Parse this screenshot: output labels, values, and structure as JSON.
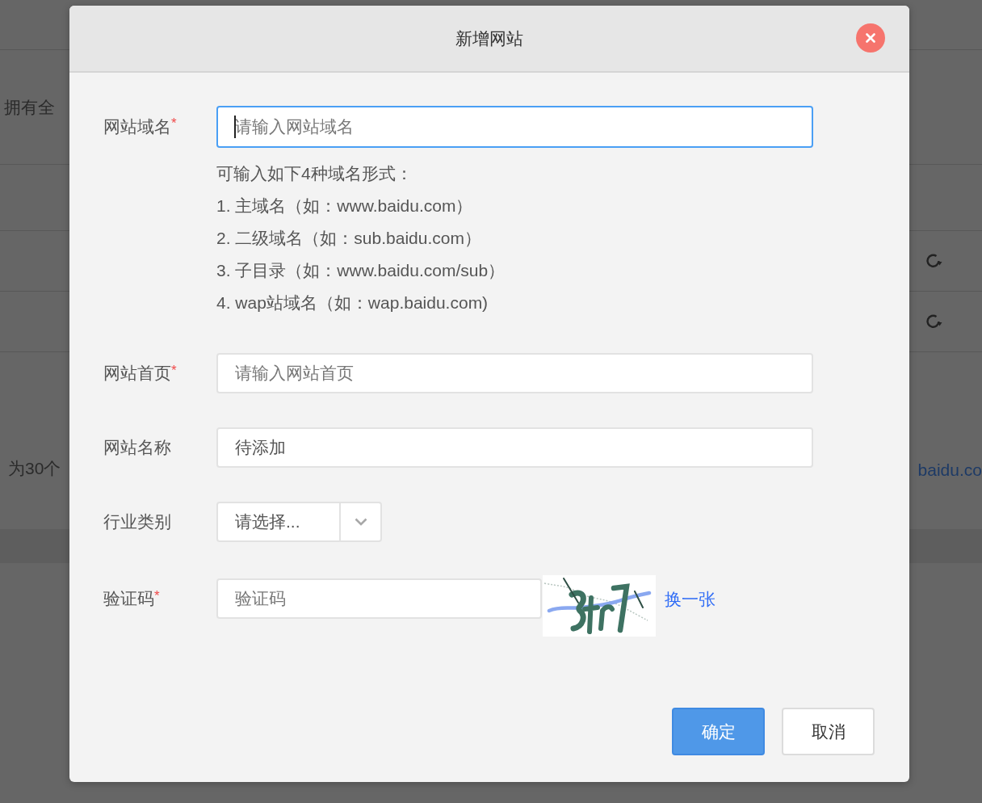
{
  "background": {
    "intro_text": "拥有全",
    "note_text": "为30个",
    "link_text": "baidu.co"
  },
  "dialog": {
    "title": "新增网站",
    "required_mark": "*",
    "fields": [
      {
        "kind": "text",
        "label": "网站域名",
        "required": true,
        "placeholder": "请输入网站域名",
        "focused": true,
        "hint": [
          "可输入如下4种域名形式：",
          "1. 主域名（如：www.baidu.com）",
          "2. 二级域名（如：sub.baidu.com）",
          "3. 子目录（如：www.baidu.com/sub）",
          "4. wap站域名（如：wap.baidu.com)"
        ]
      },
      {
        "kind": "text",
        "label": "网站首页",
        "required": true,
        "placeholder": "请输入网站首页",
        "focused": false
      },
      {
        "kind": "text",
        "label": "网站名称",
        "required": false,
        "value": "待添加",
        "focused": false
      },
      {
        "kind": "select",
        "label": "行业类别",
        "required": false,
        "value": "请选择..."
      },
      {
        "kind": "captcha",
        "label": "验证码",
        "required": true,
        "placeholder": "验证码",
        "refresh_link": "换一张"
      }
    ],
    "buttons": [
      {
        "label": "确定",
        "kind": "primary"
      },
      {
        "label": "取消",
        "kind": "default"
      }
    ]
  }
}
